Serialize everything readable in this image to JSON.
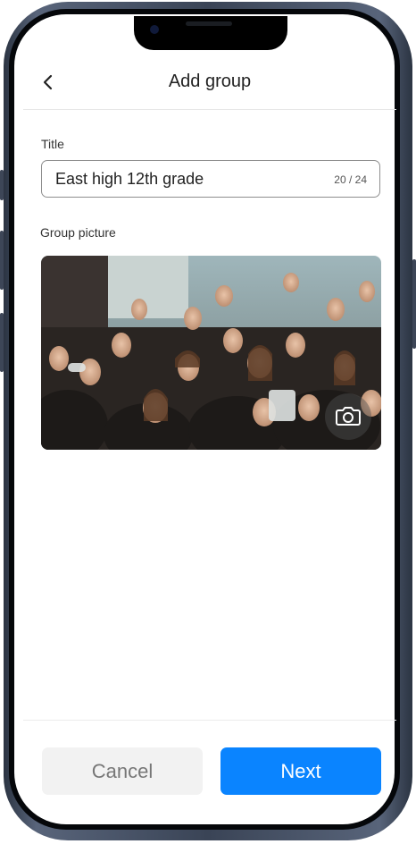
{
  "header": {
    "title": "Add group",
    "back_icon": "chevron-left-icon"
  },
  "form": {
    "title_label": "Title",
    "title_value": "East high 12th grade",
    "title_counter": "20 / 24",
    "picture_label": "Group picture",
    "camera_icon": "camera-icon"
  },
  "footer": {
    "cancel_label": "Cancel",
    "next_label": "Next"
  },
  "colors": {
    "accent": "#0a84ff",
    "cancel_bg": "#f2f2f2"
  }
}
